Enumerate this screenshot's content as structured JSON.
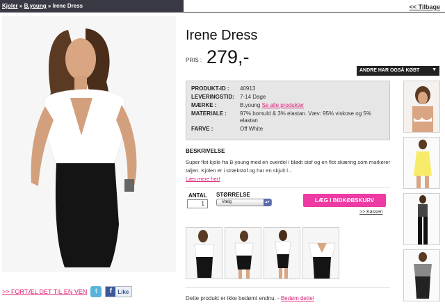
{
  "breadcrumb": {
    "items": [
      "Kjoler",
      "B.young",
      "Irene Dress"
    ],
    "separator": "»"
  },
  "back_link": "<< Tilbage",
  "product": {
    "title": "Irene Dress",
    "price_label": "PRIS :",
    "price": "279,-"
  },
  "others_bought": {
    "label": "ANDRE HAR OGSÅ KØBT"
  },
  "specs": [
    {
      "key": "PRODUKT-ID :",
      "value": "40913"
    },
    {
      "key": "LEVERINGSTID:",
      "value": "7-14 Dage"
    },
    {
      "key": "MÆRKE :",
      "value": "B.young",
      "link": "Se alle produkter"
    },
    {
      "key": "MATERIALE :",
      "value": "97% bomuld & 3% elastan. Væv: 95% viskose og 5% elastan"
    },
    {
      "key": "FARVE :",
      "value": "Off White"
    }
  ],
  "description": {
    "heading": "BESKRIVELSE",
    "text": "Super flot kjole fra B.young med en overdel i blødt stof og en flot skæring som markerer taljen. Kjolen er i strækstof og har en skjult l...",
    "more_link": "Læs mere her!"
  },
  "purchase": {
    "antal_label": "ANTAL",
    "antal_value": "1",
    "size_label": "STØRRELSE",
    "size_value": "Vælg",
    "cart_button": "LÆG I INDKØBSKURV",
    "checkout_link": ">> Kassen"
  },
  "share": {
    "tell_friend": ">> FORTÆL DET TIL EN VEN",
    "twitter_icon": "twitter-icon",
    "facebook_like": "Like"
  },
  "rating": {
    "text": "Dette produkt er ikke bedømt endnu.",
    "separator": " - ",
    "link": "Bedøm dette!"
  },
  "colors": {
    "accent": "#e0207a",
    "cart_button": "#ee3aa3",
    "topbar": "#3a3a44",
    "spec_bg": "#e6e6e6"
  }
}
